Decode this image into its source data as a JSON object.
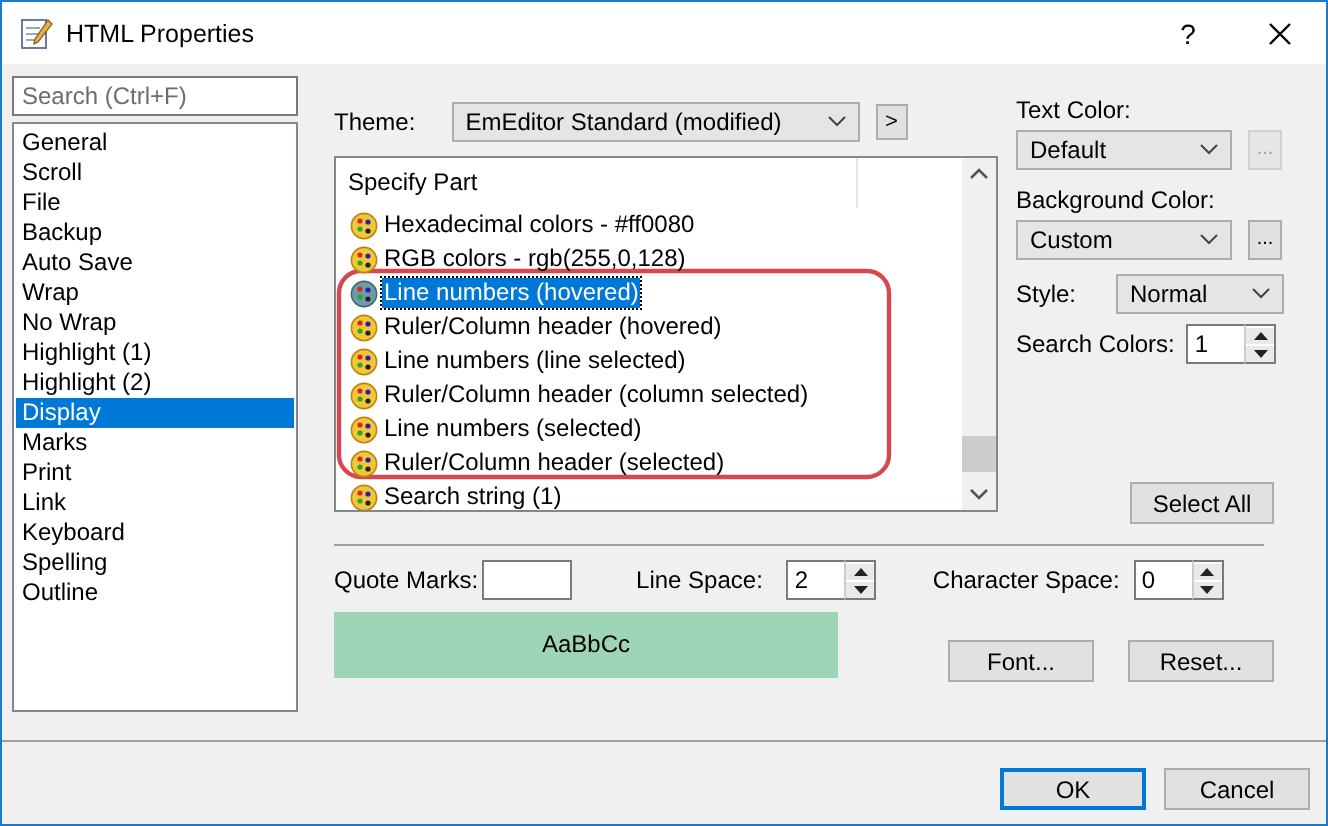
{
  "window": {
    "title": "HTML Properties",
    "help": "?"
  },
  "sidebar": {
    "search": {
      "placeholder": "Search (Ctrl+F)"
    },
    "items": [
      {
        "label": "General",
        "selected": false
      },
      {
        "label": "Scroll",
        "selected": false
      },
      {
        "label": "File",
        "selected": false
      },
      {
        "label": "Backup",
        "selected": false
      },
      {
        "label": "Auto Save",
        "selected": false
      },
      {
        "label": "Wrap",
        "selected": false
      },
      {
        "label": "No Wrap",
        "selected": false
      },
      {
        "label": "Highlight (1)",
        "selected": false
      },
      {
        "label": "Highlight (2)",
        "selected": false
      },
      {
        "label": "Display",
        "selected": true
      },
      {
        "label": "Marks",
        "selected": false
      },
      {
        "label": "Print",
        "selected": false
      },
      {
        "label": "Link",
        "selected": false
      },
      {
        "label": "Keyboard",
        "selected": false
      },
      {
        "label": "Spelling",
        "selected": false
      },
      {
        "label": "Outline",
        "selected": false
      }
    ]
  },
  "theme": {
    "label": "Theme:",
    "value": "EmEditor Standard (modified)",
    "next_button": ">"
  },
  "parts": {
    "header": "Specify Part",
    "items": [
      {
        "label": "Hexadecimal colors - #ff0080",
        "selected": false
      },
      {
        "label": "RGB colors - rgb(255,0,128)",
        "selected": false
      },
      {
        "label": "Line numbers (hovered)",
        "selected": true
      },
      {
        "label": "Ruler/Column header (hovered)",
        "selected": false
      },
      {
        "label": "Line numbers (line selected)",
        "selected": false
      },
      {
        "label": "Ruler/Column header (column selected)",
        "selected": false
      },
      {
        "label": "Line numbers (selected)",
        "selected": false
      },
      {
        "label": "Ruler/Column header (selected)",
        "selected": false
      },
      {
        "label": "Search string (1)",
        "selected": false
      }
    ]
  },
  "text_color": {
    "label": "Text Color:",
    "value": "Default",
    "more_button": "...",
    "disabled": true
  },
  "background_color": {
    "label": "Background Color:",
    "value": "Custom",
    "more_button": "...",
    "disabled": false
  },
  "style": {
    "label": "Style:",
    "value": "Normal"
  },
  "search_colors": {
    "label": "Search Colors:",
    "value": "1"
  },
  "select_all_button": "Select All",
  "quote_marks": {
    "label": "Quote Marks:"
  },
  "line_space": {
    "label": "Line Space:",
    "value": "2"
  },
  "character_space": {
    "label": "Character Space:",
    "value": "0"
  },
  "preview": "AaBbCc",
  "font_button": "Font...",
  "reset_button": "Reset...",
  "buttons": [
    {
      "label": "OK",
      "default": true
    },
    {
      "label": "Cancel",
      "default": false
    }
  ]
}
